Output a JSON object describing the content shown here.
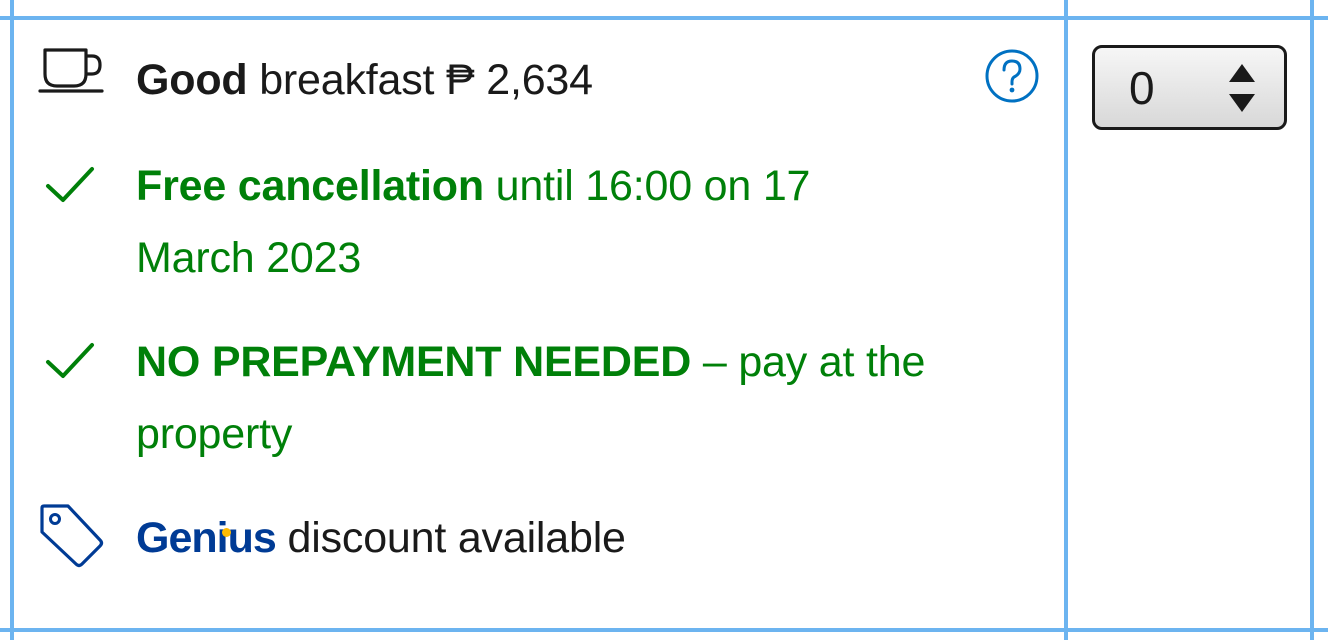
{
  "breakfast": {
    "quality": "Good",
    "label": "breakfast",
    "price": "₱ 2,634"
  },
  "cancellation": {
    "bold": "Free cancellation",
    "line1_rest": "until 16:00 on 17",
    "line2": "March 2023"
  },
  "prepayment": {
    "bold": "NO PREPAYMENT NEEDED",
    "line1_rest": "– pay at the",
    "line2": "property"
  },
  "genius": {
    "brand_prefix": "Geni",
    "brand_i": "u",
    "brand_suffix": "s",
    "text": "discount available"
  },
  "room_select": {
    "value": "0"
  },
  "colors": {
    "green": "#008009",
    "genius_blue": "#003b95",
    "grid_blue": "#6cb4f0",
    "help_blue": "#0071c2"
  },
  "icons": [
    "coffee-cup-icon",
    "checkmark-icon",
    "tag-icon",
    "help-icon",
    "up-down-arrows-icon"
  ]
}
